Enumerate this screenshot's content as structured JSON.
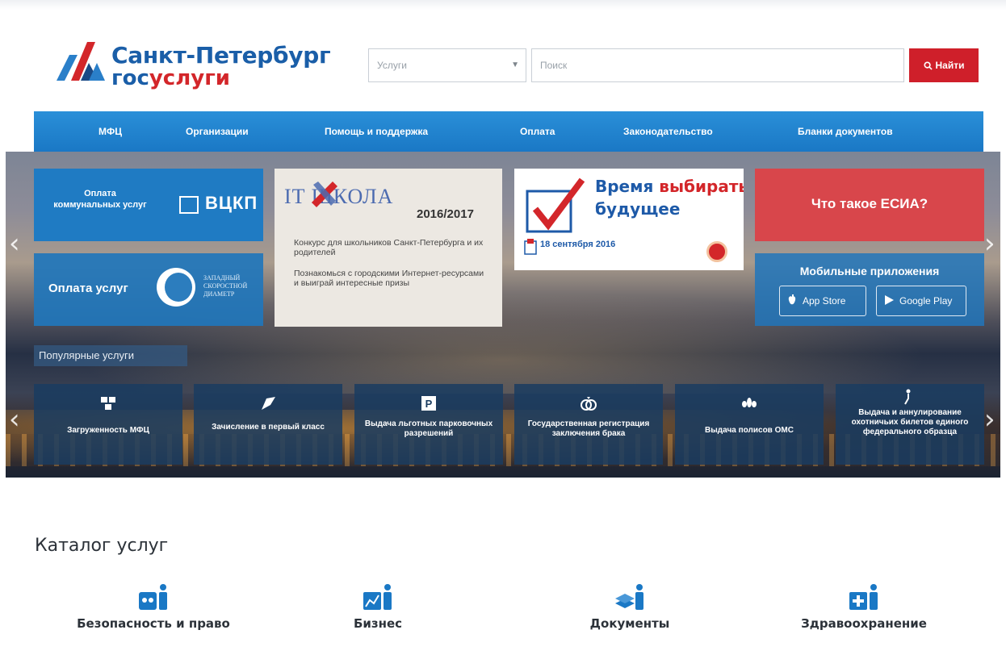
{
  "header": {
    "logo_title": "Санкт-Петербург",
    "logo_sub_a": "гос",
    "logo_sub_b": "услуги",
    "select_value": "Услуги",
    "search_placeholder": "Поиск",
    "find_label": "Найти"
  },
  "nav": {
    "items": [
      "МФЦ",
      "Организации",
      "Помощь и поддержка",
      "Оплата",
      "Законодательство",
      "Бланки документов"
    ]
  },
  "banners": {
    "vckp_label": "Оплата коммунальных услуг",
    "vckp_brand": "ВЦКП",
    "zsd_label": "Оплата услуг",
    "zsd_caption_1": "ЗАПАДНЫЙ",
    "zsd_caption_2": "СКОРОСТНОЙ",
    "zsd_caption_3": "ДИАМЕТР",
    "it_title": "IT ШКОЛА",
    "it_year": "2016/2017",
    "it_desc_1": "Конкурс для школьников Санкт-Петербурга и их родителей",
    "it_desc_2": "Познакомься с городскими Интернет-ресурсами и выиграй интересные призы",
    "vote_word_1": "Время",
    "vote_word_2": "выбирать",
    "vote_word_3": "будущее",
    "vote_date": "18 сентября 2016",
    "esia_label": "Что такое ЕСИА?",
    "mobile_label": "Мобильные приложения",
    "app_store": "App Store",
    "google_play": "Google Play"
  },
  "popular": {
    "title": "Популярные услуги",
    "items": [
      "Загруженность МФЦ",
      "Зачисление в первый класс",
      "Выдача льготных парковочных разрешений",
      "Государственная регистрация заключения брака",
      "Выдача полисов ОМС",
      "Выдача и аннулирование охотничьих билетов единого федерального образца"
    ]
  },
  "catalog": {
    "title": "Каталог услуг",
    "items": [
      "Безопасность и право",
      "Бизнес",
      "Документы",
      "Здравоохранение"
    ]
  },
  "colors": {
    "brand_blue": "#1a78c5",
    "brand_red": "#cf1f2a",
    "esia_red": "#d8464b",
    "text_dark": "#2c3239"
  },
  "icons": [
    "logo-mark-icon",
    "chevron-down-icon",
    "search-icon",
    "arrow-left-icon",
    "arrow-right-icon",
    "apple-icon",
    "google-play-icon",
    "users-icon",
    "flag-icon",
    "parking-icon",
    "rings-icon",
    "lotus-icon",
    "hunter-icon",
    "scales-icon",
    "chart-icon",
    "documents-icon",
    "medical-icon"
  ]
}
